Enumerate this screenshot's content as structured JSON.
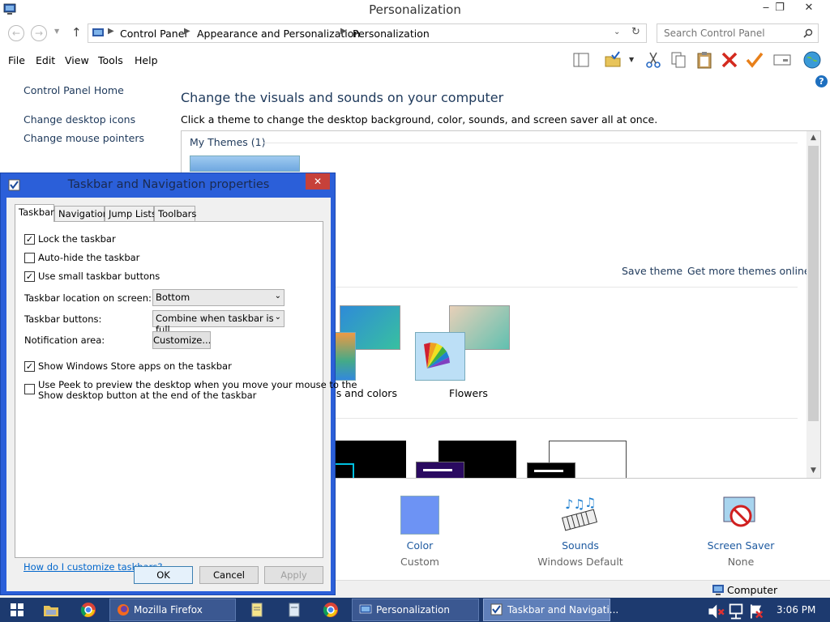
{
  "window": {
    "title": "Personalization",
    "minimize": "‒",
    "maximize": "❐",
    "close": "✕"
  },
  "address": {
    "crumbs": [
      "Control Panel",
      "Appearance and Personalization",
      "Personalization"
    ],
    "search_placeholder": "Search Control Panel"
  },
  "menu": [
    "File",
    "Edit",
    "View",
    "Tools",
    "Help"
  ],
  "left_pane": {
    "home": "Control Panel Home",
    "links": [
      "Change desktop icons",
      "Change mouse pointers"
    ]
  },
  "content": {
    "headline": "Change the visuals and sounds on your computer",
    "subline": "Click a theme to change the desktop background, color, sounds, and screen saver all at once.",
    "my_themes": "My Themes (1)",
    "save_theme": "Save theme",
    "get_more": "Get more themes online",
    "themes": [
      {
        "label": "es and colors"
      },
      {
        "label": "Flowers"
      }
    ]
  },
  "bottom": {
    "color": {
      "label": "Color",
      "value": "Custom"
    },
    "sounds": {
      "label": "Sounds",
      "value": "Windows Default"
    },
    "screensaver": {
      "label": "Screen Saver",
      "value": "None"
    }
  },
  "statusbar": {
    "text": "Computer"
  },
  "dialog": {
    "title": "Taskbar and Navigation properties",
    "tabs": [
      "Taskbar",
      "Navigation",
      "Jump Lists",
      "Toolbars"
    ],
    "active_tab": "Taskbar",
    "checks": {
      "lock": {
        "label": "Lock the taskbar",
        "checked": true
      },
      "autohide": {
        "label": "Auto-hide the taskbar",
        "checked": false
      },
      "small": {
        "label": "Use small taskbar buttons",
        "checked": true
      },
      "store": {
        "label": "Show Windows Store apps on the taskbar",
        "checked": true
      },
      "peek_line1": "Use Peek to preview the desktop when you move your mouse to the",
      "peek_line2": "Show desktop button at the end of the taskbar",
      "peek_checked": false
    },
    "location_label": "Taskbar location on screen:",
    "location_value": "Bottom",
    "buttons_label": "Taskbar buttons:",
    "buttons_value": "Combine when taskbar is full",
    "notif_label": "Notification area:",
    "customize": "Customize...",
    "help_link": "How do I customize taskbars?",
    "ok": "OK",
    "cancel": "Cancel",
    "apply": "Apply"
  },
  "taskbar": {
    "tasks": [
      "Mozilla Firefox",
      "Personalization",
      "Taskbar and Navigati..."
    ],
    "clock": "3:06 PM"
  },
  "colors": {
    "dialog_frame": "#2b5fd9",
    "taskbar": "#1d3a6f",
    "link": "#1e395b"
  }
}
